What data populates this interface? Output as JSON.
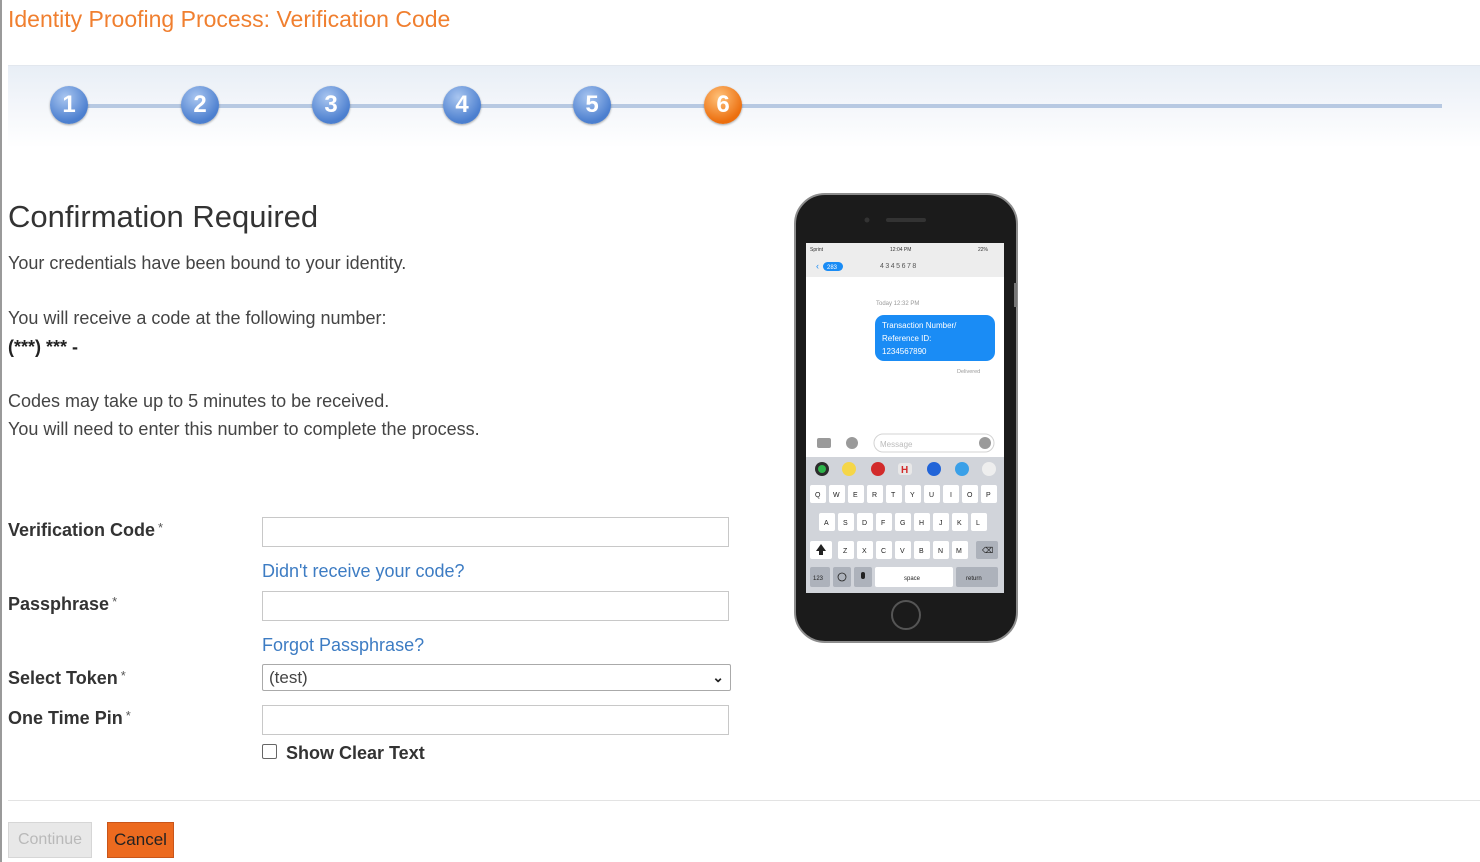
{
  "page": {
    "title": "Identity Proofing Process: Verification Code"
  },
  "stepper": {
    "steps": [
      "1",
      "2",
      "3",
      "4",
      "5",
      "6"
    ],
    "active": 6
  },
  "main": {
    "heading": "Confirmation Required",
    "credentials_text": "Your credentials have been bound to your identity.",
    "receive_text": "You will receive a code at the following number:",
    "phone_number": "(***) *** -",
    "codes_time_text": "Codes may take up to 5 minutes to be received.",
    "enter_number_text": "You will need to enter this number to complete the process."
  },
  "form": {
    "verification_code_label": "Verification Code",
    "required_marker": "*",
    "resend_link": "Didn't receive your code?",
    "passphrase_label": "Passphrase",
    "forgot_link": "Forgot Passphrase?",
    "token_label": "Select Token",
    "token_selected": "(test)",
    "otp_label": "One Time Pin",
    "show_clear_text_label": "Show Clear Text"
  },
  "actions": {
    "continue_label": "Continue",
    "cancel_label": "Cancel"
  },
  "phone_mock": {
    "status_carrier": "Sprint",
    "status_time": "12:04 PM",
    "status_battery": "22%",
    "back_badge": "283",
    "sender": "4345678",
    "timestamp": "Today 12:32 PM",
    "message_line1": "Transaction Number/",
    "message_line2": "Reference ID:",
    "message_line3": "1234567890",
    "delivered": "Delivered",
    "input_placeholder": "Message",
    "keyboard_row1": [
      "Q",
      "W",
      "E",
      "R",
      "T",
      "Y",
      "U",
      "I",
      "O",
      "P"
    ],
    "keyboard_row2": [
      "A",
      "S",
      "D",
      "F",
      "G",
      "H",
      "J",
      "K",
      "L"
    ],
    "keyboard_row3": [
      "Z",
      "X",
      "C",
      "V",
      "B",
      "N",
      "M"
    ],
    "key_123": "123",
    "key_space": "space",
    "key_return": "return"
  },
  "colors": {
    "accent_orange": "#ec6f0f",
    "step_blue": "#4c7fcf",
    "link_blue": "#3d7cc3",
    "imessage_blue": "#1a8cf5"
  }
}
